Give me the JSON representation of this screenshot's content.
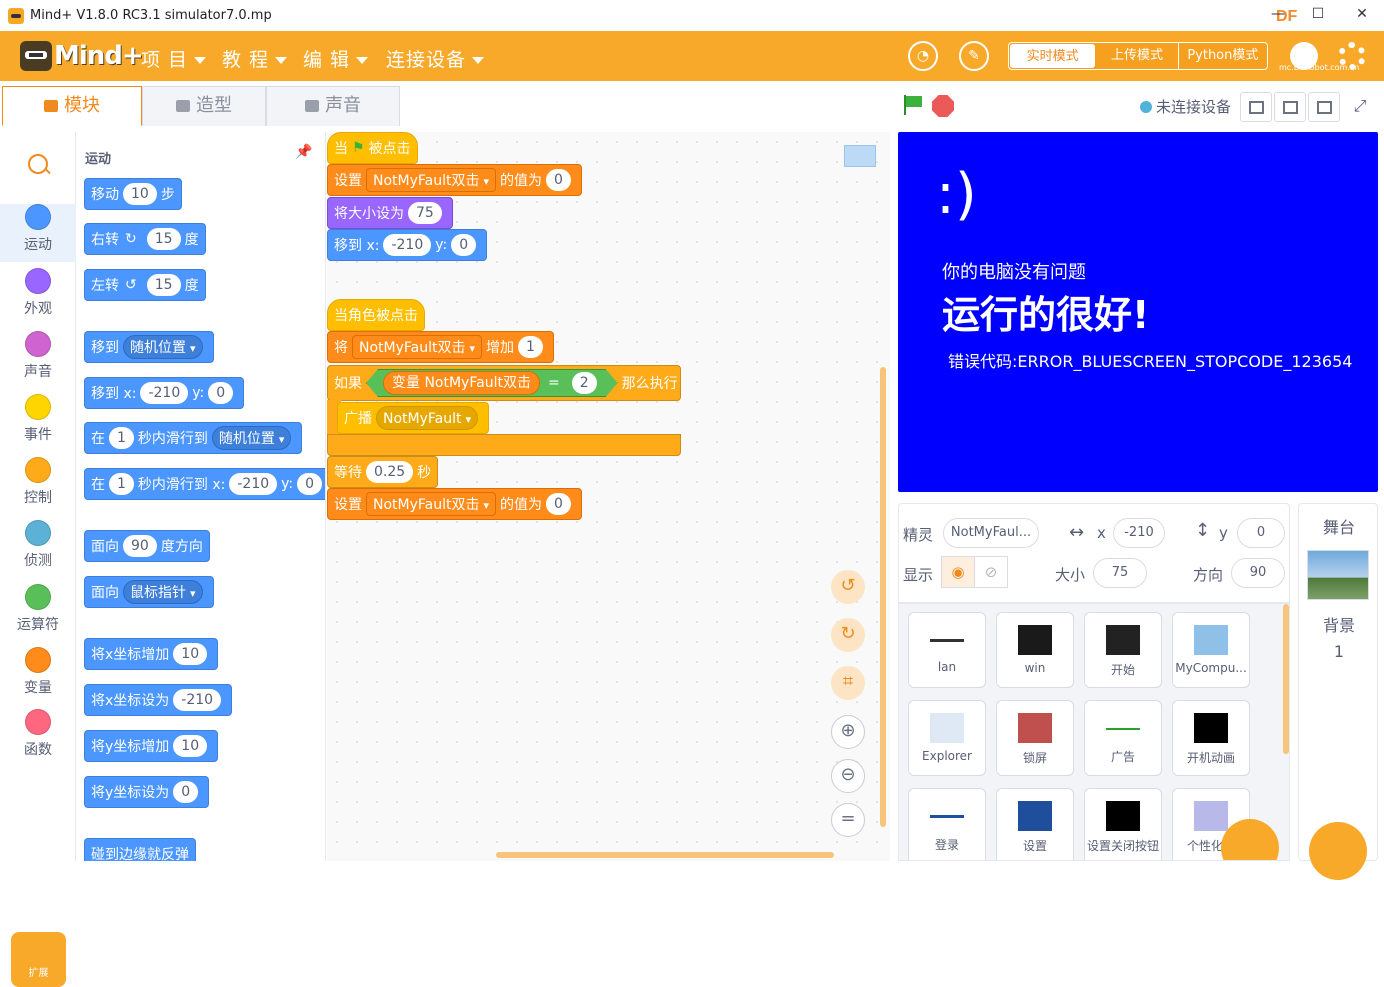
{
  "window": {
    "title": "Mind+ V1.8.0 RC3.1    simulator7.0.mp",
    "brand": "DF",
    "brand_url": "mc.DFRobot.com.cn"
  },
  "menubar": {
    "logo": "Mind+",
    "items": [
      "项 目",
      "教 程",
      "编 辑",
      "连接设备"
    ],
    "modes": [
      "实时模式",
      "上传模式",
      "Python模式"
    ]
  },
  "tabs": [
    "模块",
    "造型",
    "声音"
  ],
  "connection": "未连接设备",
  "categories": [
    {
      "label": "运动",
      "color": "#4c97ff"
    },
    {
      "label": "外观",
      "color": "#9966ff"
    },
    {
      "label": "声音",
      "color": "#cf63cf"
    },
    {
      "label": "事件",
      "color": "#ffd500"
    },
    {
      "label": "控制",
      "color": "#ffab19"
    },
    {
      "label": "侦测",
      "color": "#5cb1d6"
    },
    {
      "label": "运算符",
      "color": "#59c059"
    },
    {
      "label": "变量",
      "color": "#ff8c1a"
    },
    {
      "label": "函数",
      "color": "#ff6680"
    }
  ],
  "extension_label": "扩展",
  "palette": {
    "heading": "运动",
    "blocks": {
      "move": [
        "移动",
        "10",
        "步"
      ],
      "turn_right": [
        "右转",
        "15",
        "度"
      ],
      "turn_left": [
        "左转",
        "15",
        "度"
      ],
      "goto": [
        "移到",
        "随机位置"
      ],
      "goto_xy": [
        "移到 x:",
        "-210",
        "y:",
        "0"
      ],
      "glide": [
        "在",
        "1",
        "秒内滑行到",
        "随机位置"
      ],
      "glide_xy": [
        "在",
        "1",
        "秒内滑行到 x:",
        "-210",
        "y:",
        "0"
      ],
      "point_dir": [
        "面向",
        "90",
        "度方向"
      ],
      "point_towards": [
        "面向",
        "鼠标指针"
      ],
      "change_x": [
        "将x坐标增加",
        "10"
      ],
      "set_x": [
        "将x坐标设为",
        "-210"
      ],
      "change_y": [
        "将y坐标增加",
        "10"
      ],
      "set_y": [
        "将y坐标设为",
        "0"
      ],
      "bounce": [
        "碰到边缘就反弹"
      ]
    }
  },
  "script": {
    "s1_hat": [
      "当",
      "被点击"
    ],
    "s1_set": [
      "设置",
      "NotMyFault双击",
      "的值为",
      "0"
    ],
    "s1_size": [
      "将大小设为",
      "75"
    ],
    "s1_goto": [
      "移到 x:",
      "-210",
      "y:",
      "0"
    ],
    "s2_hat": "当角色被点击",
    "s2_change": [
      "将",
      "NotMyFault双击",
      "增加",
      "1"
    ],
    "s2_if": [
      "如果",
      "变量",
      "NotMyFault双击",
      "=",
      "2",
      "那么执行"
    ],
    "s2_broadcast": [
      "广播",
      "NotMyFault"
    ],
    "s2_wait": [
      "等待",
      "0.25",
      "秒"
    ],
    "s2_set": [
      "设置",
      "NotMyFault双击",
      "的值为",
      "0"
    ]
  },
  "stage": {
    "smile": ":)",
    "line1": "你的电脑没有问题",
    "line2": "运行的很好!",
    "line3": "错误代码:ERROR_BLUESCREEN_STOPCODE_123654"
  },
  "sprite_info": {
    "sprite_label": "精灵",
    "sprite_name": "NotMyFaul...",
    "x_label": "x",
    "x": "-210",
    "y_label": "y",
    "y": "0",
    "show_label": "显示",
    "size_label": "大小",
    "size": "75",
    "dir_label": "方向",
    "dir": "90"
  },
  "sprites": [
    "lan",
    "win",
    "开始",
    "MyCompu...",
    "Explorer",
    "锁屏",
    "广告",
    "开机动画",
    "登录",
    "设置",
    "设置关闭按钮",
    "个性化设"
  ],
  "stage_panel": {
    "title": "舞台",
    "bg_label": "背景",
    "bg_count": "1"
  }
}
